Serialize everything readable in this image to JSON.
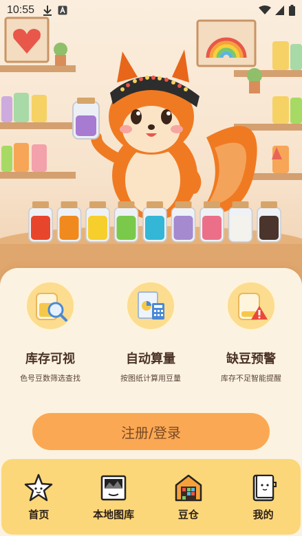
{
  "status_bar": {
    "time": "10:55",
    "left_icons": [
      "download-icon",
      "notification-a-icon"
    ],
    "right_icons": [
      "wifi-icon",
      "signal-icon",
      "battery-icon"
    ]
  },
  "hero": {
    "description_icons": [
      "heart-frame-icon",
      "rainbow-frame-icon",
      "squirrel-mascot-icon"
    ],
    "jar_colors": [
      "#e8462c",
      "#f08a1e",
      "#f7cf2c",
      "#7bc94a",
      "#34b7d6",
      "#a58ad0",
      "#ec6f8a",
      "#f4f2ec",
      "#4a342c"
    ]
  },
  "features": [
    {
      "title": "库存可视",
      "subtitle": "色号豆数筛选查找",
      "icon": "jar-search-icon"
    },
    {
      "title": "自动算量",
      "subtitle": "按图纸计算用豆量",
      "icon": "calculator-chart-icon"
    },
    {
      "title": "缺豆预警",
      "subtitle": "库存不足智能提醒",
      "icon": "jar-warning-icon"
    }
  ],
  "login": {
    "label": "注册/登录"
  },
  "tabs": [
    {
      "label": "首页",
      "icon": "star-icon"
    },
    {
      "label": "本地图库",
      "icon": "gallery-icon"
    },
    {
      "label": "豆仓",
      "icon": "warehouse-icon"
    },
    {
      "label": "我的",
      "icon": "profile-book-icon"
    }
  ],
  "colors": {
    "accent": "#fba854",
    "tab_bar": "#fcd779",
    "card": "#fbf2e2",
    "feature_circle": "#fcdc8f"
  }
}
